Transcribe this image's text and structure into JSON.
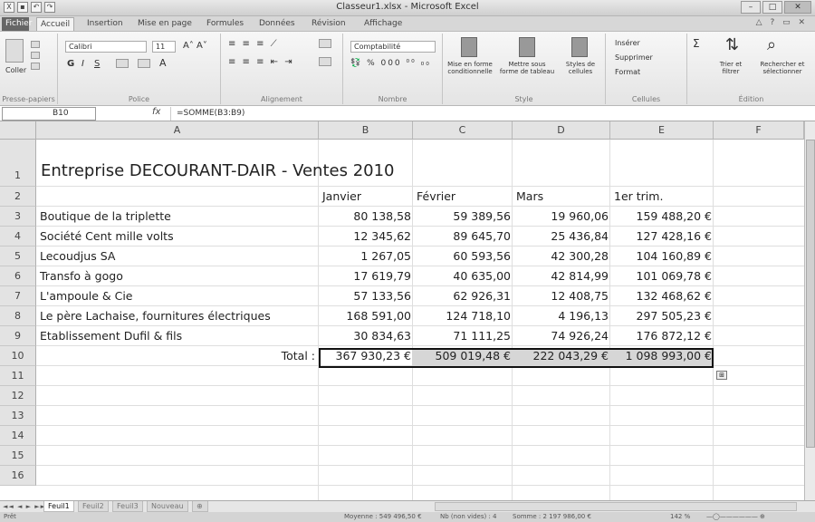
{
  "window": {
    "title": "Classeur1.xlsx - Microsoft Excel",
    "controls": [
      "–",
      "□",
      "✕"
    ]
  },
  "ribbon_tabs": [
    "Fichier",
    "Accueil",
    "Insertion",
    "Mise en page",
    "Formules",
    "Données",
    "Révision",
    "Affichage"
  ],
  "ribbon": {
    "clipboard": {
      "paste": "Coller",
      "label": "Presse-papiers"
    },
    "font": {
      "name": "Calibri",
      "size": "11",
      "bold": "G",
      "italic": "I",
      "underline": "S",
      "label": "Police"
    },
    "alignment": {
      "label": "Alignement"
    },
    "number": {
      "format": "Comptabilité",
      "label": "Nombre"
    },
    "style": {
      "cond_format": "Mise en forme conditionnelle",
      "table_format": "Mettre sous forme de tableau",
      "cell_styles": "Styles de cellules",
      "label": "Style"
    },
    "cells": {
      "insert": "Insérer",
      "delete": "Supprimer",
      "format": "Format",
      "label": "Cellules"
    },
    "editing": {
      "sort": "Trier et filtrer",
      "find": "Rechercher et sélectionner",
      "label": "Édition"
    }
  },
  "formula_bar": {
    "name_box": "B10",
    "fx": "fx",
    "formula": "=SOMME(B3:B9)"
  },
  "columns": [
    "A",
    "B",
    "C",
    "D",
    "E",
    "F"
  ],
  "rows": [
    "1",
    "2",
    "3",
    "4",
    "5",
    "6",
    "7",
    "8",
    "9",
    "10",
    "11",
    "12",
    "13",
    "14",
    "15",
    "16"
  ],
  "sheet": {
    "title": "Entreprise DECOURANT-DAIR - Ventes 2010",
    "headers": [
      "Janvier",
      "Février",
      "Mars",
      "1er trim."
    ],
    "data": [
      {
        "name": "Boutique de la triplette",
        "b": "80 138,58",
        "c": "59 389,56",
        "d": "19 960,06",
        "e": "159 488,20 €"
      },
      {
        "name": "Société Cent mille volts",
        "b": "12 345,62",
        "c": "89 645,70",
        "d": "25 436,84",
        "e": "127 428,16 €"
      },
      {
        "name": "Lecoudjus SA",
        "b": "1 267,05",
        "c": "60 593,56",
        "d": "42 300,28",
        "e": "104 160,89 €"
      },
      {
        "name": "Transfo à gogo",
        "b": "17 619,79",
        "c": "40 635,00",
        "d": "42 814,99",
        "e": "101 069,78 €"
      },
      {
        "name": "L'ampoule & Cie",
        "b": "57 133,56",
        "c": "62 926,31",
        "d": "12 408,75",
        "e": "132 468,62 €"
      },
      {
        "name": "Le père Lachaise, fournitures électriques",
        "b": "168 591,00",
        "c": "124 718,10",
        "d": "4 196,13",
        "e": "297 505,23 €"
      },
      {
        "name": "Etablissement Dufil & fils",
        "b": "30 834,63",
        "c": "71 111,25",
        "d": "74 926,24",
        "e": "176 872,12 €"
      }
    ],
    "total_label": "Total :",
    "totals": [
      "367 930,23 €",
      "509 019,48 €",
      "222 043,29 €",
      "1 098 993,00 €"
    ]
  },
  "sheet_tabs": [
    "Feuil1",
    "Feuil2",
    "Feuil3",
    "Nouveau"
  ],
  "active_sheet": "Feuil1",
  "status": {
    "mode": "Prêt",
    "average": "Moyenne : 549 496,50 €",
    "count": "Nb (non vides) : 4",
    "sum": "Somme : 2 197 986,00 €",
    "zoom": "142 %"
  }
}
